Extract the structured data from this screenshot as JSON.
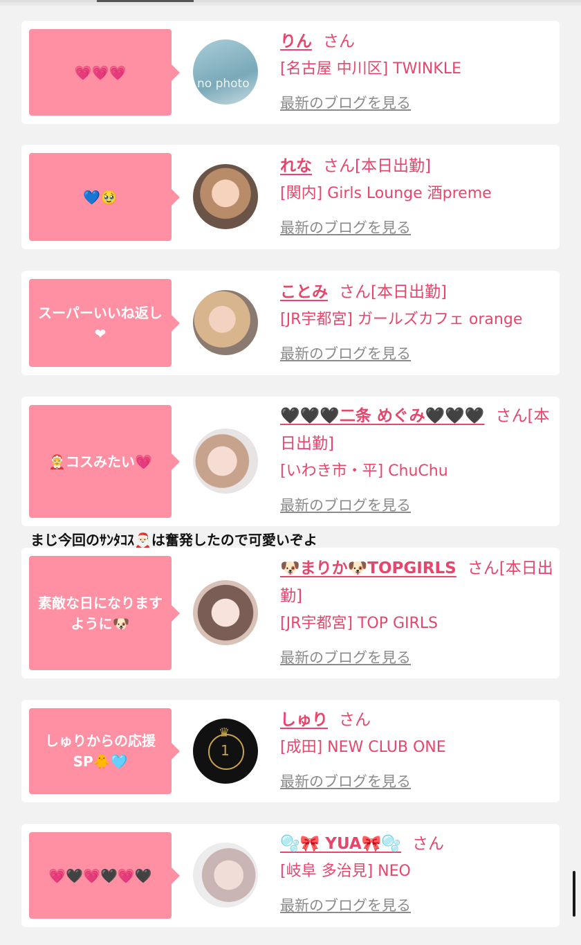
{
  "overlay_caption": "まじ今回のｻﾝﾀｺｽ🎅🏻は奮発したので可愛いぞよ",
  "entries": [
    {
      "comment": "💗💗💗",
      "name": "りん",
      "suffix": "さん",
      "shop": "[名古屋 中川区] TWINKLE",
      "blog_link": "最新のブログを見る",
      "avatar_text": "no photo"
    },
    {
      "comment": "💙🥹",
      "name": "れな",
      "suffix": "さん[本日出勤]",
      "shop": "[関内] Girls Lounge 酒preme",
      "blog_link": "最新のブログを見る"
    },
    {
      "comment": "スーパーいいね返し❤︎",
      "name": "ことみ",
      "suffix": "さん[本日出勤]",
      "shop": "[JR宇都宮] ガールズカフェ orange",
      "blog_link": "最新のブログを見る"
    },
    {
      "comment": "🤶コスみたい💗",
      "name": "🖤🖤🖤二条 めぐみ🖤🖤🖤",
      "suffix": "さん[本日出勤]",
      "shop": "[いわき市・平] ChuChu",
      "blog_link": "最新のブログを見る"
    },
    {
      "comment": "素敵な日になりますように🐶",
      "name": "🐶まりか🐶TOPGIRLS",
      "suffix": "さん[本日出勤]",
      "shop": "[JR宇都宮] TOP GIRLS",
      "blog_link": "最新のブログを見る"
    },
    {
      "comment": "しゅりからの応援SP🐥🩵",
      "name": "しゅり",
      "suffix": "さん",
      "shop": "[成田] NEW CLUB ONE",
      "blog_link": "最新のブログを見る",
      "avatar_text": "1"
    },
    {
      "comment": "💗🖤💗🖤💗🖤",
      "name": "🫧🎀 YUA🎀🫧",
      "suffix": "さん",
      "shop": "[岐阜 多治見] NEO",
      "blog_link": "最新のブログを見る"
    }
  ],
  "colors": {
    "page_bg": "#f2f2f2",
    "bubble": "#ff8fa3",
    "accent_text": "#e8456b",
    "link_gray": "#8a8a8a"
  }
}
